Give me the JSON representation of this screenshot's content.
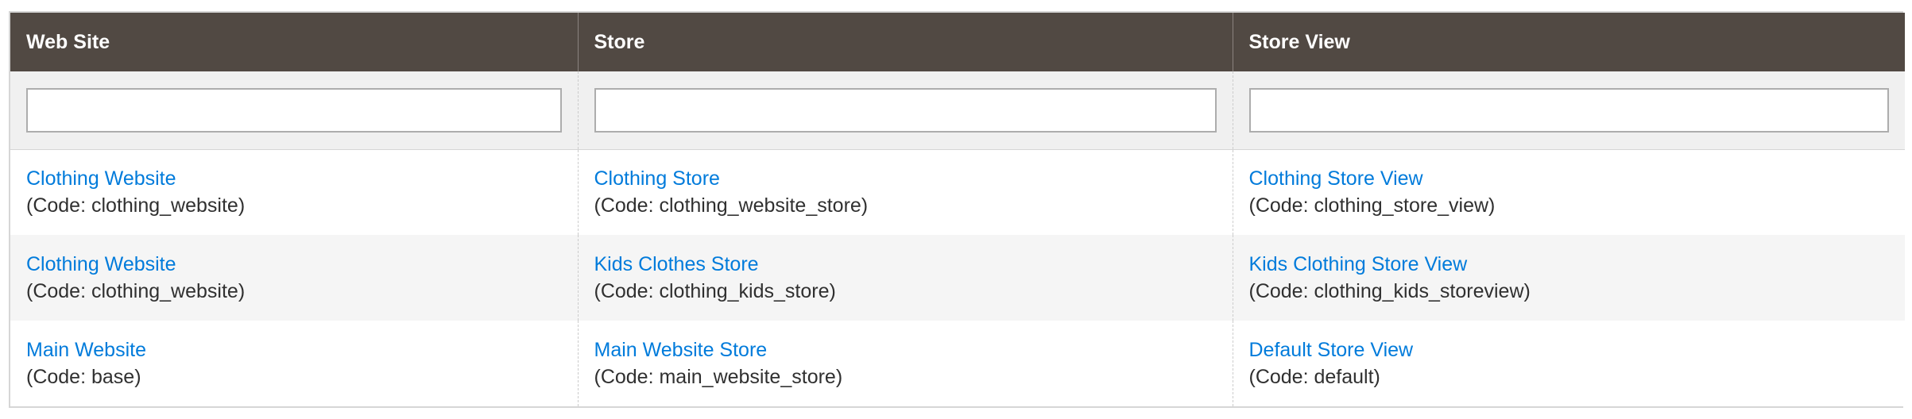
{
  "columns": {
    "website": "Web Site",
    "store": "Store",
    "store_view": "Store View"
  },
  "filters": {
    "website": "",
    "store": "",
    "store_view": ""
  },
  "rows": [
    {
      "website": {
        "name": "Clothing Website",
        "code": "(Code: clothing_website)"
      },
      "store": {
        "name": "Clothing Store",
        "code": "(Code: clothing_website_store)"
      },
      "store_view": {
        "name": "Clothing Store View",
        "code": "(Code: clothing_store_view)"
      }
    },
    {
      "website": {
        "name": "Clothing Website",
        "code": "(Code: clothing_website)"
      },
      "store": {
        "name": "Kids Clothes Store",
        "code": "(Code: clothing_kids_store)"
      },
      "store_view": {
        "name": "Kids Clothing Store View",
        "code": "(Code: clothing_kids_storeview)"
      }
    },
    {
      "website": {
        "name": "Main Website",
        "code": "(Code: base)"
      },
      "store": {
        "name": "Main Website Store",
        "code": "(Code: main_website_store)"
      },
      "store_view": {
        "name": "Default Store View",
        "code": "(Code: default)"
      }
    }
  ],
  "colors": {
    "header_bg": "#514943",
    "link": "#007bdb",
    "text": "#303030",
    "row_alt": "#f5f5f5"
  }
}
